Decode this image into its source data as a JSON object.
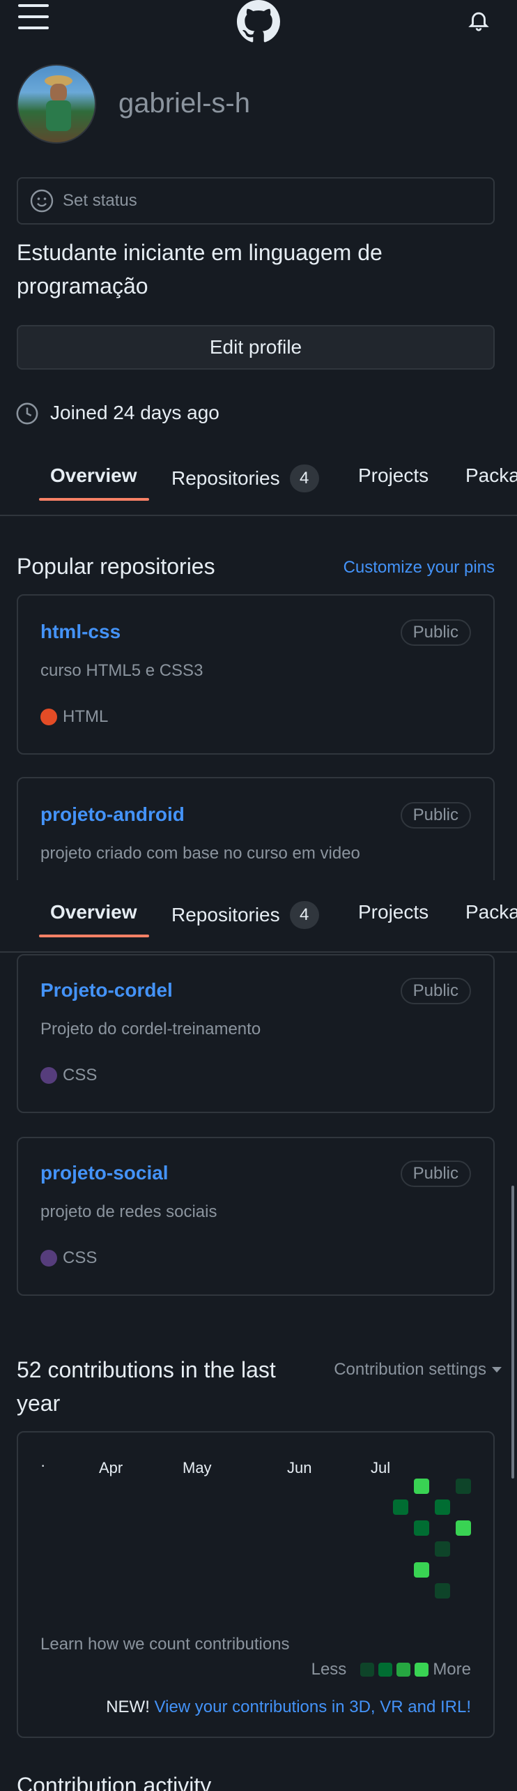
{
  "header": {
    "menu_icon": "hamburger-icon",
    "logo_icon": "github-logo-icon",
    "notifications_icon": "bell-icon"
  },
  "profile": {
    "username": "gabriel-s-h",
    "status_placeholder": "Set status",
    "bio": "Estudante iniciante em linguagem de programação",
    "edit_button": "Edit profile",
    "joined": "Joined 24 days ago"
  },
  "tabs": [
    {
      "label": "Overview",
      "selected": true
    },
    {
      "label": "Repositories",
      "count": "4"
    },
    {
      "label": "Projects"
    },
    {
      "label": "Packages"
    }
  ],
  "popular": {
    "title": "Popular repositories",
    "customize_link": "Customize your pins",
    "repos": [
      {
        "name": "html-css",
        "visibility": "Public",
        "description": "curso HTML5 e CSS3",
        "language": "HTML",
        "language_color": "#e34c26"
      },
      {
        "name": "projeto-android",
        "visibility": "Public",
        "description": "projeto criado com base no curso em video"
      },
      {
        "name": "Projeto-cordel",
        "visibility": "Public",
        "description": "Projeto do cordel-treinamento",
        "language": "CSS",
        "language_color": "#563d7c"
      },
      {
        "name": "projeto-social",
        "visibility": "Public",
        "description": "projeto de redes sociais",
        "language": "CSS",
        "language_color": "#563d7c"
      }
    ]
  },
  "contributions": {
    "title": "52 contributions in the last year",
    "settings": "Contribution settings",
    "months": [
      "Apr",
      "May",
      "Jun",
      "Jul"
    ],
    "learn_link": "Learn how we count contributions",
    "legend_less": "Less",
    "legend_more": "More",
    "new_label": "NEW!",
    "new_link": "View your contributions in 3D, VR and IRL!"
  },
  "activity": {
    "title": "Contribution activity"
  },
  "colors": {
    "background": "#161b22",
    "border": "#30363d",
    "link": "#4493f8",
    "tab_accent": "#f78166",
    "muted": "#8b949e"
  }
}
